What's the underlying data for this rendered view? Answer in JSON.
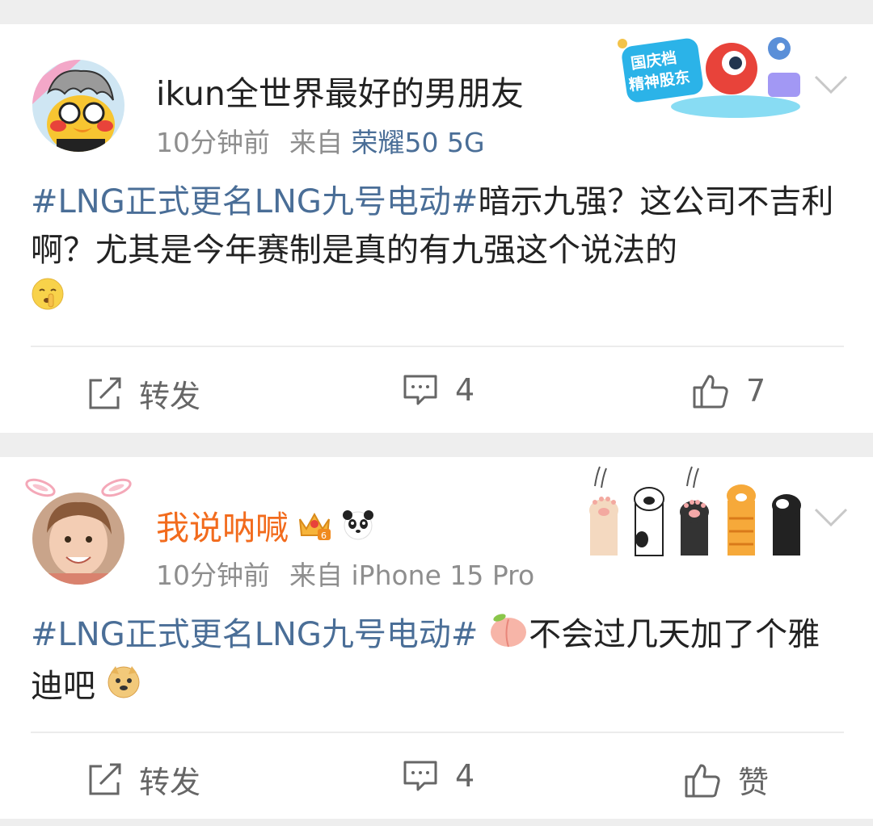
{
  "posts": [
    {
      "username": "ikun全世界最好的男朋友",
      "time": "10分钟前",
      "source_prefix": "来自",
      "device": "荣耀50 5G",
      "topic": "#LNG正式更名LNG九号电动#",
      "text": "暗示九强？这公司不吉利啊？尤其是今年赛制是真的有九强这个说法的",
      "emoji": "shush-face-emoji",
      "badge_text": "国庆档 精神股东",
      "actions": {
        "repost": "转发",
        "comments": "4",
        "likes": "7"
      }
    },
    {
      "username": "我说呐喊",
      "time": "10分钟前",
      "source_prefix": "来自",
      "device": "iPhone 15 Pro",
      "topic": "#LNG正式更名LNG九号电动#",
      "text_before": "不会过几天加了个雅迪吧",
      "actions": {
        "repost": "转发",
        "comments": "4",
        "likes": "赞"
      }
    }
  ],
  "colors": {
    "topic": "#4a6e97",
    "vip_name": "#f26b1d",
    "meta": "#8e8e8e",
    "background": "#eeeeee"
  }
}
